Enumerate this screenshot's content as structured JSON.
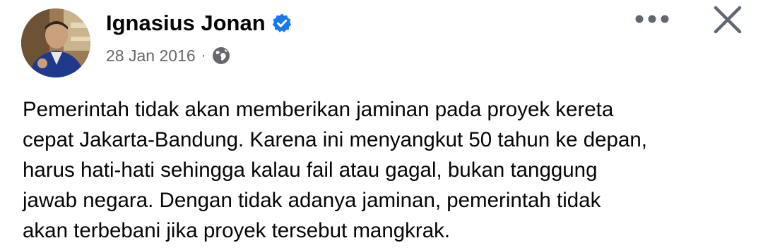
{
  "post": {
    "author": {
      "name": "Ignasius Jonan",
      "verified": true
    },
    "date": "28 Jan 2016",
    "separator": "·",
    "audience_icon": "globe-icon",
    "text_lines": [
      "Pemerintah tidak akan memberikan jaminan pada proyek kereta",
      "cepat Jakarta-Bandung. Karena ini menyangkut 50 tahun ke depan,",
      "harus hati-hati sehingga kalau fail atau gagal, bukan tanggung",
      "jawab negara. Dengan tidak adanya jaminan, pemerintah tidak",
      "akan terbebani jika proyek tersebut mangkrak."
    ]
  },
  "icons": {
    "verified": "verified-badge-icon",
    "more": "more-options-icon",
    "close": "close-icon"
  },
  "colors": {
    "verified_blue": "#1877f2",
    "meta_gray": "#65676b",
    "icon_gray": "#606770",
    "text": "#050505"
  }
}
